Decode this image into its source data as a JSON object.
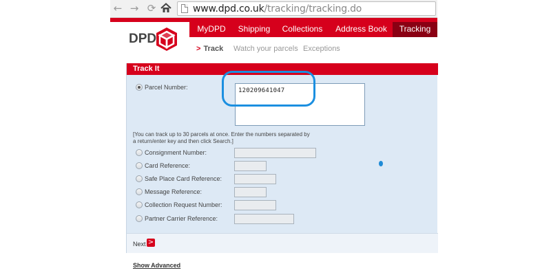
{
  "browser": {
    "url_host": "www.dpd.co.uk",
    "url_path": "/tracking/tracking.do",
    "back_glyph": "←",
    "forward_glyph": "→",
    "reload_glyph": "⟳"
  },
  "site": {
    "logo_text": "DPD",
    "nav_tabs": [
      {
        "label": "MyDPD",
        "active": false
      },
      {
        "label": "Shipping",
        "active": false
      },
      {
        "label": "Collections",
        "active": false
      },
      {
        "label": "Address Book",
        "active": false
      },
      {
        "label": "Tracking",
        "active": true
      }
    ],
    "subnav": {
      "arrow": ">",
      "items": [
        "Track",
        "Watch your parcels",
        "Exceptions"
      ]
    }
  },
  "form": {
    "title": "Track It",
    "parcel_number_label": "Parcel Number:",
    "parcel_number_value": "120209641047",
    "hint": "[You can track up to 30 parcels at once. Enter the numbers separated by a return/enter key and then click Search.]",
    "reference_fields": [
      {
        "label": "Consignment Number:",
        "value": ""
      },
      {
        "label": "Card Reference:",
        "value": ""
      },
      {
        "label": "Safe Place Card Reference:",
        "value": ""
      },
      {
        "label": "Message Reference:",
        "value": ""
      },
      {
        "label": "Collection Request Number:",
        "value": ""
      },
      {
        "label": "Partner Carrier Reference:",
        "value": ""
      }
    ],
    "next_label": "Next",
    "next_arrow": ">",
    "show_advanced": "Show Advanced"
  },
  "colors": {
    "brand_red": "#d6001c",
    "active_tab": "#8a0013",
    "panel_bg": "#dde9f5",
    "annotation_blue": "#1b8fe0"
  },
  "icons": [
    "back-arrow-icon",
    "forward-arrow-icon",
    "reload-icon",
    "home-icon",
    "page-icon",
    "dpd-cube-logo",
    "next-arrow-icon"
  ]
}
